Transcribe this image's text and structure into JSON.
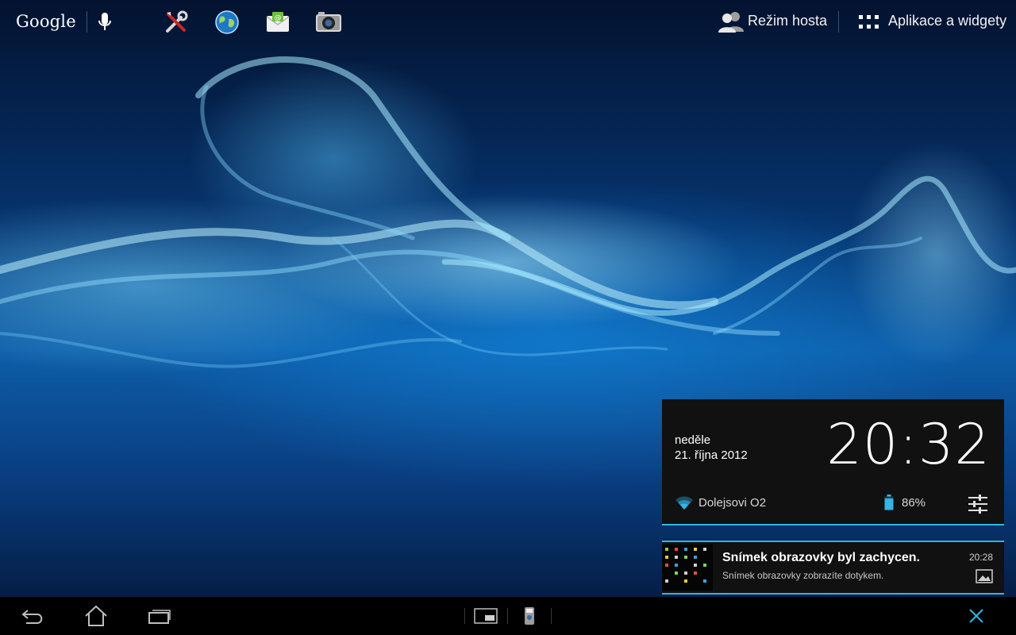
{
  "topbar": {
    "google_label": "Google",
    "guest_mode_label": "Režim hosta",
    "apps_widgets_label": "Aplikace a widgety"
  },
  "shortcuts": [
    {
      "icon": "settings-tools-icon"
    },
    {
      "icon": "browser-globe-icon"
    },
    {
      "icon": "email-icon"
    },
    {
      "icon": "camera-icon"
    }
  ],
  "quick_settings": {
    "day": "neděle",
    "date": "21. října 2012",
    "time": "20:32",
    "wifi_network": "Dolejsovi O2",
    "battery": "86%",
    "battery_level": 0.86
  },
  "notification": {
    "title": "Snímek obrazovky byl zachycen.",
    "text": "Snímek obrazovky zobrazíte dotykem.",
    "time": "20:28"
  },
  "colors": {
    "accent": "#33b5e5",
    "panel_bg": "#111111",
    "navbar_bg": "#000000"
  }
}
